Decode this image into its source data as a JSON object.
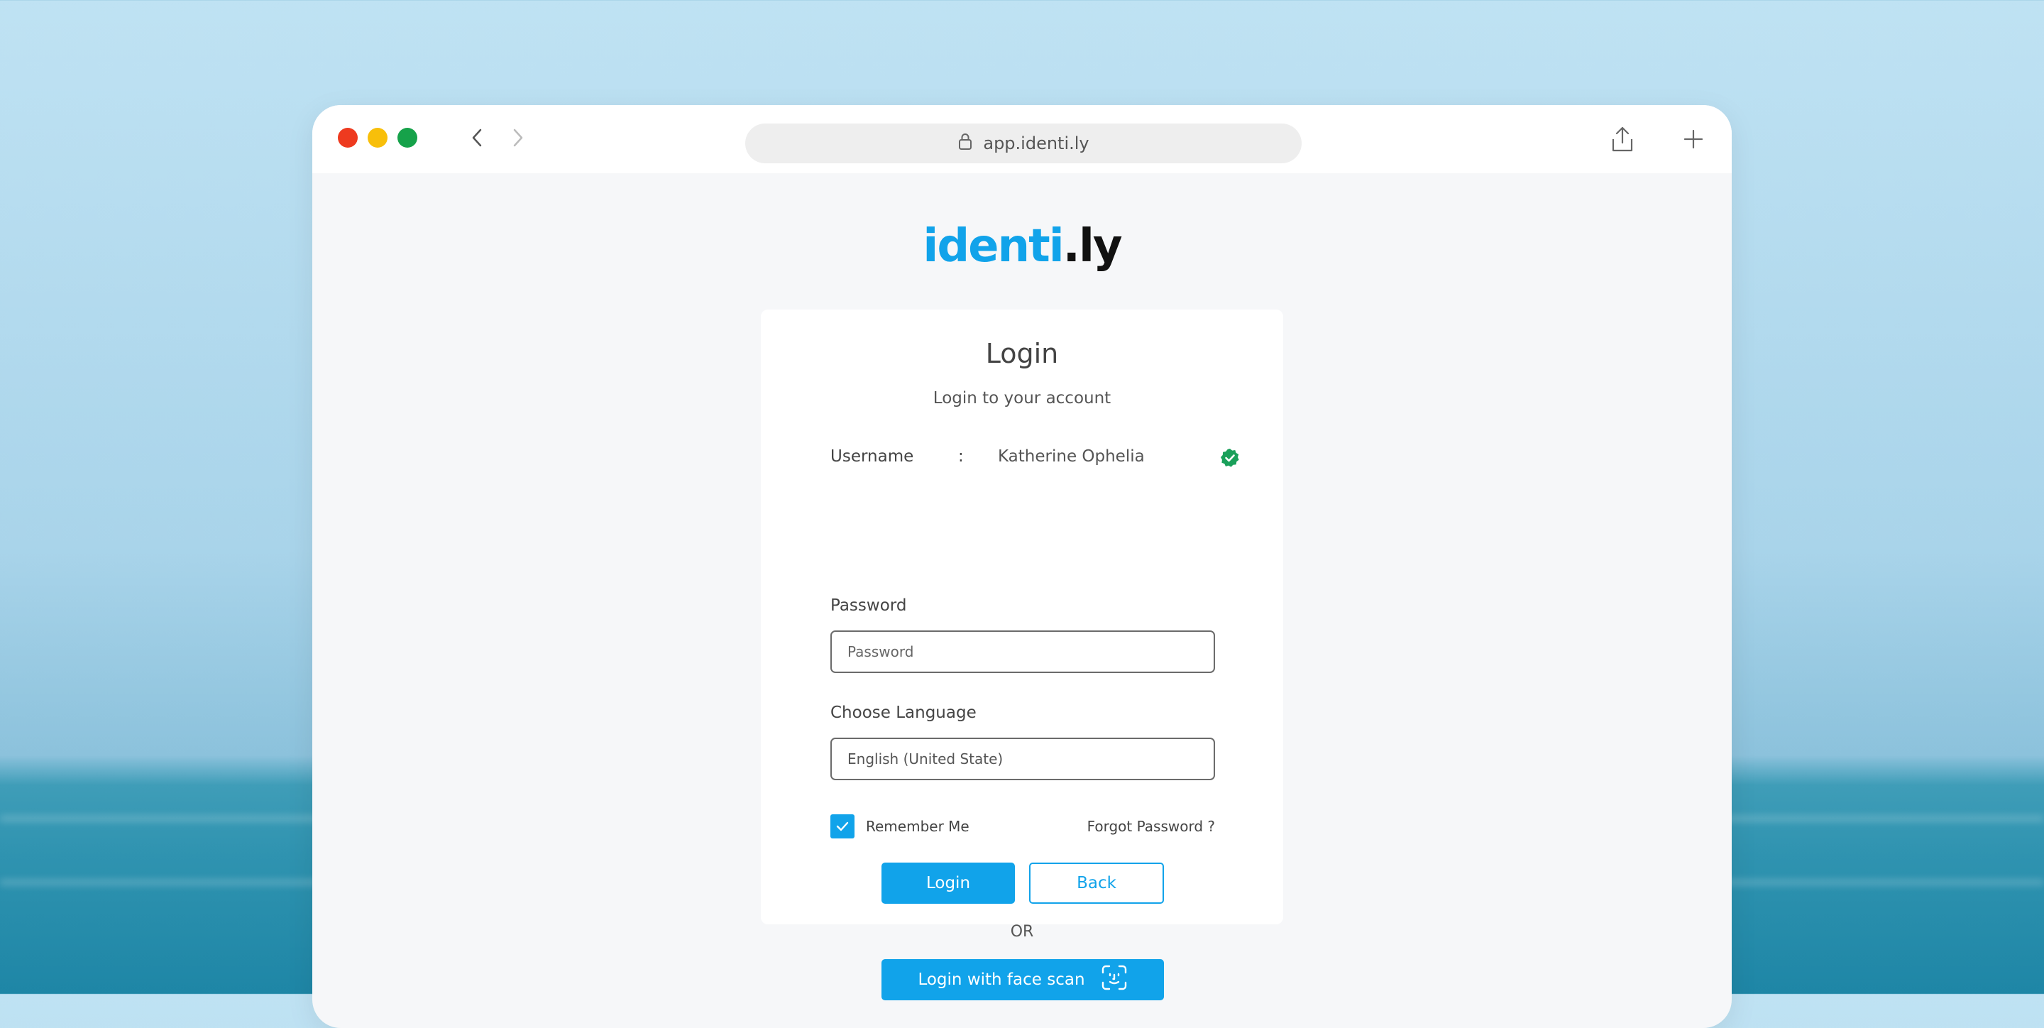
{
  "browser": {
    "url": "app.identi.ly",
    "icons": [
      "close-dot",
      "minimize-dot",
      "maximize-dot",
      "chevron-left-icon",
      "chevron-right-icon",
      "lock-icon",
      "share-icon",
      "plus-icon"
    ]
  },
  "logo": {
    "part1": "identi",
    "part2": ".ly",
    "color_primary": "#11a3ea",
    "color_secondary": "#111111"
  },
  "login": {
    "title": "Login",
    "subtitle": "Login to your account",
    "username_label": "Username",
    "username_separator": ":",
    "username_value": "Katherine Ophelia",
    "password_label": "Password",
    "password_placeholder": "Password",
    "password_value": "",
    "language_label": "Choose Language",
    "language_value": "English (United State)",
    "remember_label": "Remember Me",
    "remember_checked": true,
    "forgot_label": "Forgot Password ?",
    "login_button": "Login",
    "back_button": "Back",
    "or_text": "OR",
    "face_scan_button": "Login with face scan"
  },
  "colors": {
    "accent": "#11a3ea",
    "verified": "#1aa05a",
    "traffic_red": "#ee3a1f",
    "traffic_yellow": "#f8bf0a",
    "traffic_green": "#16a24a"
  }
}
